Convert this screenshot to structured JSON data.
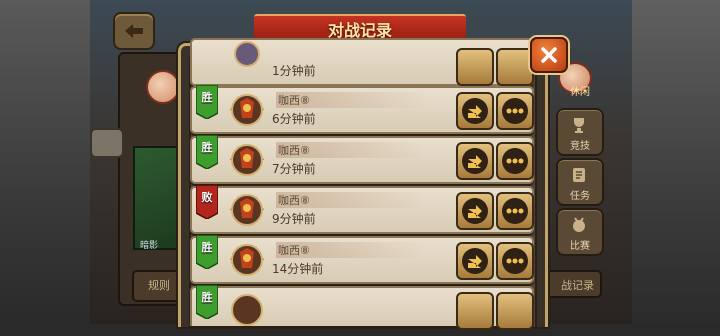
{
  "title": "对战记录",
  "background": {
    "rule_button": "规则",
    "record_button": "战记录",
    "shadow_label": "暗影",
    "side_tabs": [
      {
        "label": "休闲",
        "icon": "jester-icon",
        "active": true
      },
      {
        "label": "竞技",
        "icon": "trophy-icon",
        "active": false
      },
      {
        "label": "任务",
        "icon": "scroll-icon",
        "active": false
      },
      {
        "label": "比赛",
        "icon": "medal-icon",
        "active": false
      }
    ]
  },
  "records": [
    {
      "result": "",
      "name": "",
      "time": "1分钟前",
      "partial": "top"
    },
    {
      "result": "胜",
      "name": "咖西⑧",
      "time": "6分钟前",
      "partial": "none"
    },
    {
      "result": "胜",
      "name": "咖西⑧",
      "time": "7分钟前",
      "partial": "none"
    },
    {
      "result": "败",
      "name": "咖西⑧",
      "time": "9分钟前",
      "partial": "none"
    },
    {
      "result": "胜",
      "name": "咖西⑧",
      "time": "14分钟前",
      "partial": "none"
    },
    {
      "result": "胜",
      "name": "",
      "time": "",
      "partial": "bottom"
    }
  ],
  "colors": {
    "win": "#3f9c2e",
    "lose": "#b3261d",
    "banner": "#c53322",
    "close": "#e86a2a"
  }
}
